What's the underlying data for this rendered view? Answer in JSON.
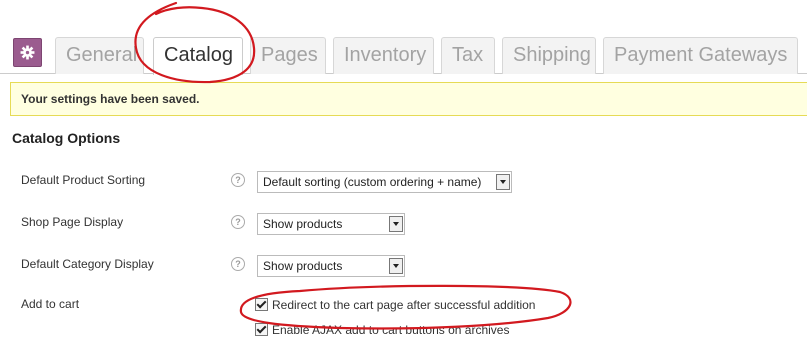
{
  "tabs": [
    {
      "label": "General"
    },
    {
      "label": "Catalog",
      "active": true
    },
    {
      "label": "Pages"
    },
    {
      "label": "Inventory"
    },
    {
      "label": "Tax"
    },
    {
      "label": "Shipping"
    },
    {
      "label": "Payment Gateways"
    }
  ],
  "settings_icon": "gear-icon",
  "notice": "Your settings have been saved.",
  "section_title": "Catalog Options",
  "fields": {
    "product_sorting": {
      "label": "Default Product Sorting",
      "value": "Default sorting (custom ordering + name)"
    },
    "shop_display": {
      "label": "Shop Page Display",
      "value": "Show products"
    },
    "category_display": {
      "label": "Default Category Display",
      "value": "Show products"
    },
    "add_to_cart": {
      "label": "Add to cart",
      "options": [
        {
          "label": "Redirect to the cart page after successful addition",
          "checked": true
        },
        {
          "label": "Enable AJAX add to cart buttons on archives",
          "checked": true
        }
      ]
    }
  },
  "help_glyph": "?",
  "colors": {
    "accent": "#9b5c8f",
    "notice_bg": "#ffffe0",
    "notice_border": "#e6db55",
    "annotation": "#d2191f"
  }
}
